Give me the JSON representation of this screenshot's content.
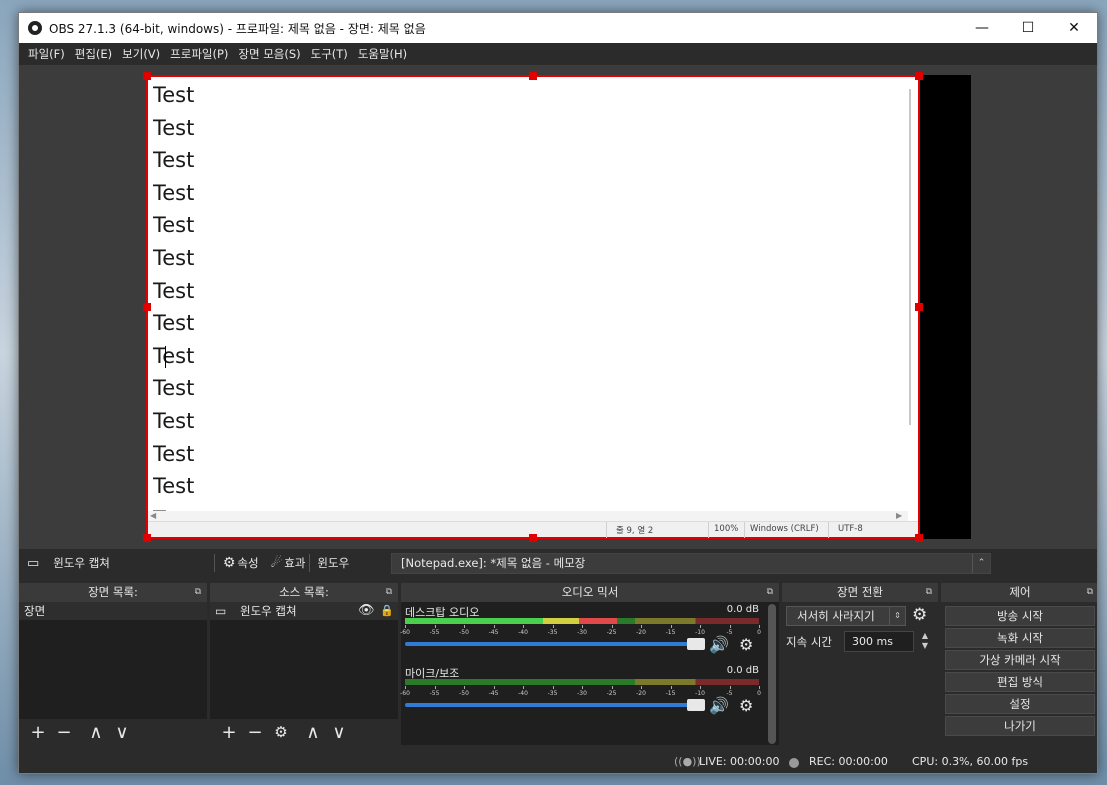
{
  "titlebar": {
    "title": "OBS 27.1.3 (64-bit, windows) - 프로파일: 제목 없음 - 장면: 제목 없음",
    "minimize_glyph": "—",
    "maximize_glyph": "☐",
    "close_glyph": "✕"
  },
  "menu": {
    "items": [
      "파일(F)",
      "편집(E)",
      "보기(V)",
      "프로파일(P)",
      "장면 모음(S)",
      "도구(T)",
      "도움말(H)"
    ]
  },
  "preview": {
    "lines": [
      "Test",
      "Test",
      "Test",
      "Test",
      "Test",
      "Test",
      "Test",
      "Test",
      "Test",
      "Test",
      "Test",
      "Test",
      "Test",
      "Test"
    ],
    "status": {
      "position": "줄 9, 열 2",
      "zoom": "100%",
      "line_ending": "Windows (CRLF)",
      "encoding": "UTF-8"
    }
  },
  "source_toolbar": {
    "source_name": "윈도우 캡쳐",
    "properties_label": "속성",
    "filters_label": "효과",
    "window_label": "윈도우",
    "window_value": "[Notepad.exe]: *제목 없음 - 메모장"
  },
  "scenes": {
    "title": "장면 목록:",
    "items": [
      "장면"
    ]
  },
  "sources": {
    "title": "소스 목록:",
    "items": [
      "윈도우 캡쳐"
    ]
  },
  "mixer": {
    "title": "오디오 믹서",
    "ticks": [
      "-60",
      "-55",
      "-50",
      "-45",
      "-40",
      "-35",
      "-30",
      "-25",
      "-20",
      "-15",
      "-10",
      "-5",
      "0"
    ],
    "channels": [
      {
        "name": "데스크탑 오디오",
        "db": "0.0 dB",
        "level": 0.6,
        "volume": 1.0
      },
      {
        "name": "마이크/보조",
        "db": "0.0 dB",
        "level": 0.0,
        "volume": 1.0
      }
    ]
  },
  "transitions": {
    "title": "장면 전환",
    "selected": "서서히 사라지기",
    "duration_label": "지속 시간",
    "duration_value": "300 ms"
  },
  "controls": {
    "title": "제어",
    "buttons": [
      "방송 시작",
      "녹화 시작",
      "가상 카메라 시작",
      "편집 방식",
      "설정",
      "나가기"
    ]
  },
  "statusbar": {
    "live": "LIVE: 00:00:00",
    "rec": "REC: 00:00:00",
    "cpu": "CPU: 0.3%, 60.00 fps"
  },
  "colors": {
    "accent_selection": "#e00000",
    "slider_blue": "#2f7bd6",
    "meter_green": "#4ccf4c",
    "meter_yellow": "#d0d040",
    "meter_red": "#e04a4a",
    "panel_bg": "#2b2b2b"
  }
}
